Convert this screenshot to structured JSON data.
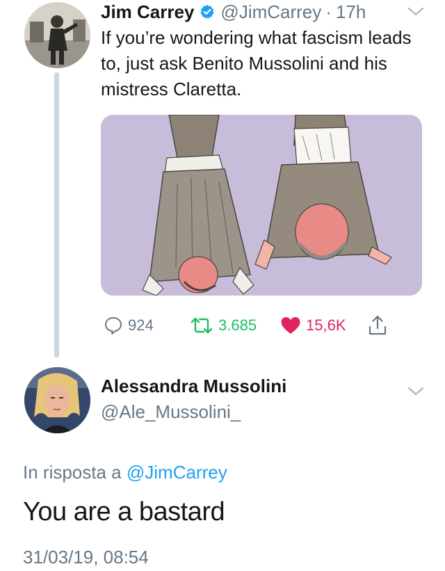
{
  "tweet": {
    "author_name": "Jim Carrey",
    "author_handle": "@JimCarrey",
    "separator": "·",
    "time": "17h",
    "text": "If you’re wondering what fascism leads to, just ask Benito Mussolini and his mistress Claretta.",
    "stats": {
      "replies": "924",
      "retweets": "3.685",
      "likes": "15,6K"
    }
  },
  "reply": {
    "author_name": "Alessandra Mussolini",
    "author_handle": "@Ale_Mussolini_",
    "in_reply_prefix": "In risposta a",
    "in_reply_mention": "@JimCarrey",
    "text": "You are a bastard",
    "timestamp": "31/03/19, 08:54"
  },
  "icons": {
    "verified": "verified-badge-icon",
    "reply": "reply-bubble-icon",
    "retweet": "retweet-icon",
    "like": "heart-icon",
    "share": "share-icon",
    "menu": "chevron-down-icon"
  },
  "colors": {
    "text": "#14171a",
    "muted": "#657786",
    "link": "#1da1f2",
    "retweet": "#17bf63",
    "like": "#e0245e",
    "media_bg": "#c7bddb"
  }
}
